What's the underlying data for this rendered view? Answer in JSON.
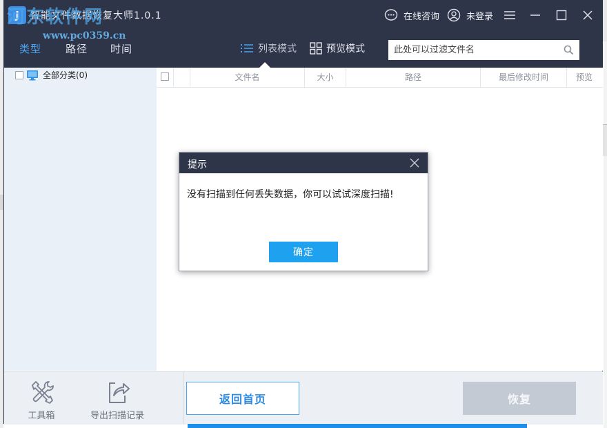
{
  "app": {
    "title": "智能文件数据恢复大师1.0.1",
    "icon_glyph": "J",
    "watermark_cn": "河东软件网",
    "watermark_url": "www.pc0359.cn"
  },
  "header": {
    "consult_label": "在线咨询",
    "login_label": "未登录",
    "icons": [
      "chat-bubble-icon",
      "user-circle-icon",
      "menu-icon",
      "minimize-icon",
      "maximize-icon",
      "close-icon"
    ]
  },
  "nav": {
    "tabs": [
      {
        "label": "类型",
        "active": true
      },
      {
        "label": "路径",
        "active": false
      },
      {
        "label": "时间",
        "active": false
      }
    ],
    "list_mode_label": "列表模式",
    "preview_mode_label": "预览模式",
    "active_view": "列表模式"
  },
  "filter": {
    "placeholder": "此处可以过滤文件名",
    "value": ""
  },
  "categories": {
    "all_label": "全部分类(0)"
  },
  "table": {
    "columns": [
      "",
      "",
      "文件名",
      "大小",
      "路径",
      "最后修改时间",
      "预览"
    ],
    "rows": []
  },
  "bottom": {
    "toolbox_label": "工具箱",
    "export_label": "导出扫描记录",
    "home_button": "返回首页",
    "recover_button": "恢复"
  },
  "dialog": {
    "title": "提示",
    "message": "没有扫描到任何丢失数据，你可以试试深度扫描!",
    "ok_button": "确定"
  },
  "colors": {
    "header_bg": "#2f3549",
    "accent": "#4aa4f2",
    "ok_button": "#1ea1ee",
    "left_panel": "#eaf0f8",
    "disabled_button": "#c3cad4"
  }
}
